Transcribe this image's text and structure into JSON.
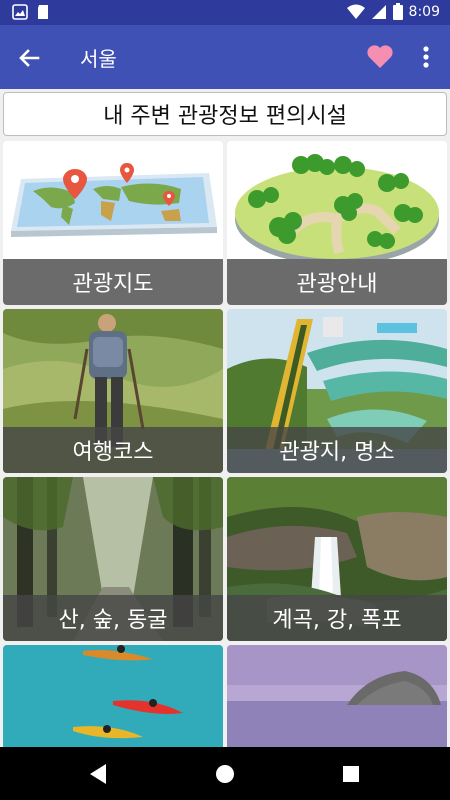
{
  "status_bar": {
    "time": "8:09"
  },
  "app_bar": {
    "title": "서울",
    "accent": "#3f51b5",
    "heart_color": "#f48fb1"
  },
  "tabs": {
    "label": "내 주변 관광정보 편의시설"
  },
  "cards": [
    {
      "caption": "관광지도",
      "image": "world-map"
    },
    {
      "caption": "관광안내",
      "image": "park-map"
    },
    {
      "caption": "여행코스",
      "image": "hiker"
    },
    {
      "caption": "관광지, 명소",
      "image": "water-slide"
    },
    {
      "caption": "산, 숲, 동굴",
      "image": "forest"
    },
    {
      "caption": "계곡, 강, 폭포",
      "image": "waterfall"
    },
    {
      "caption": "",
      "image": "kayaks"
    },
    {
      "caption": "",
      "image": "sea-island"
    }
  ]
}
